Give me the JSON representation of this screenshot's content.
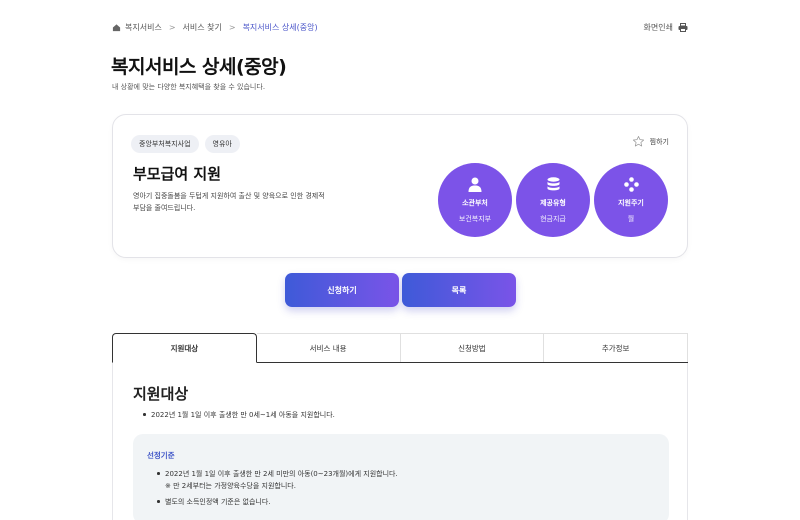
{
  "breadcrumb": {
    "items": [
      "복지서비스",
      "서비스 찾기",
      "복지서비스 상세(중앙)"
    ]
  },
  "header": {
    "print_label": "화면인쇄",
    "title": "복지서비스 상세(중앙)",
    "description": "내 상황에 맞는 다양한 복지혜택을 찾을 수 있습니다."
  },
  "card": {
    "tags": [
      "중앙부처복지사업",
      "영유아"
    ],
    "favorite_label": "찜하기",
    "service_name": "부모급여 지원",
    "service_desc": "영아기 집중돌봄을 두텁게 지원하여 출산 및 양육으로 인한 경제적 부담을 줄여드립니다.",
    "info": [
      {
        "label": "소관부처",
        "value": "보건복지부",
        "icon": "person-icon"
      },
      {
        "label": "제공유형",
        "value": "현금지급",
        "icon": "coins-icon"
      },
      {
        "label": "지원주기",
        "value": "월",
        "icon": "diamond-dots-icon"
      }
    ]
  },
  "actions": {
    "apply_label": "신청하기",
    "list_label": "목록"
  },
  "tabs": [
    "지원대상",
    "서비스 내용",
    "신청방법",
    "추가정보"
  ],
  "content": {
    "section_title": "지원대상",
    "bullet": "2022년 1월 1일 이후 출생한 만 0세~1세 아동을 지원합니다.",
    "criteria_title": "선정기준",
    "criteria": [
      "2022년 1월 1일 이후 출생한 만 2세 미만의 아동(0~23개월)에게 지원합니다.",
      "별도의 소득인정액 기준은 없습니다."
    ],
    "criteria_note": "※ 만 2세부터는 가정양육수당을 지원합니다."
  },
  "colors": {
    "accent": "#7c53e8",
    "button_start": "#3e5ad8",
    "button_end": "#7a54e8",
    "link": "#4a55c9"
  }
}
